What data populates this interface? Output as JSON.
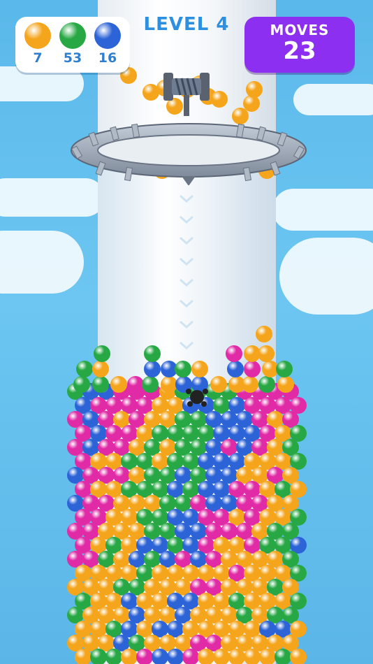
{
  "hud": {
    "ball_counters": [
      {
        "color_name": "orange",
        "color": "#f5a51c",
        "count": "7"
      },
      {
        "color_name": "green",
        "color": "#27a844",
        "count": "53"
      },
      {
        "color_name": "blue",
        "color": "#2c63d6",
        "count": "16"
      }
    ],
    "level_label": "LEVEL 4",
    "moves_label": "MOVES",
    "moves_value": "23"
  },
  "palette": {
    "orange": "#f5a51c",
    "green": "#27a844",
    "blue": "#2c63d6",
    "pink": "#e02aa6",
    "sky": "#5ab8ea",
    "tower": "#f4f7fa",
    "saw_ring": "#9aa6b6",
    "moves_panel": "#8d2ff0"
  },
  "icons": {
    "saw": "spinning-saw-ring-icon",
    "axle": "rope-axle-icon",
    "bomb": "bomb-icon"
  }
}
